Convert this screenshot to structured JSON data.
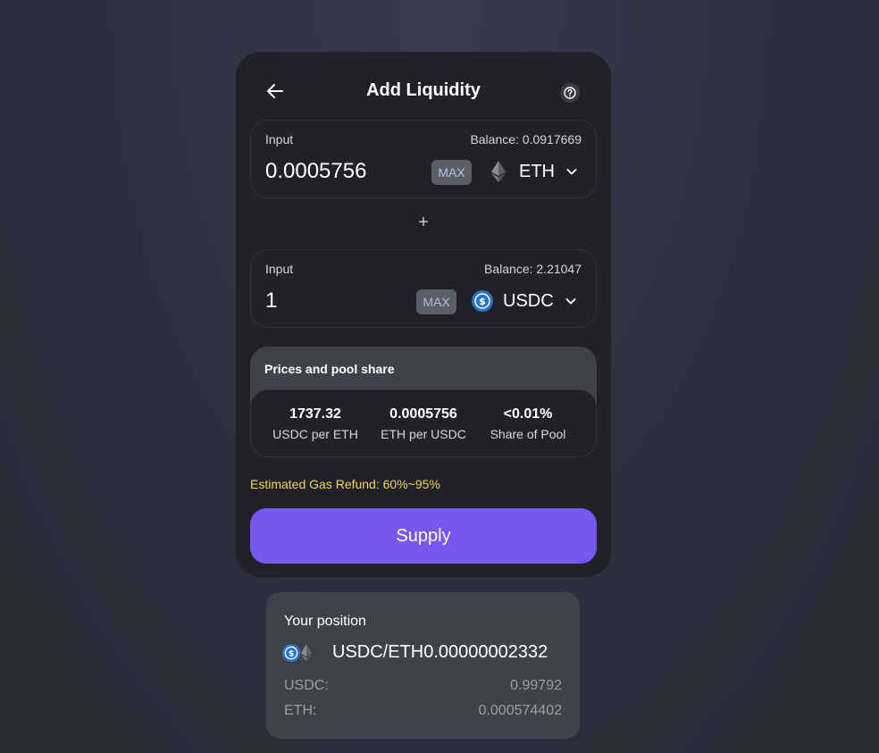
{
  "header": {
    "title": "Add Liquidity",
    "back_icon": "arrow-left-icon",
    "help_icon": "question-circle-icon"
  },
  "input_a": {
    "label": "Input",
    "balance": "Balance: 0.0917669",
    "value": "0.0005756",
    "max_label": "MAX",
    "token": "ETH",
    "token_icon": "eth-icon"
  },
  "plus_symbol": "+",
  "input_b": {
    "label": "Input",
    "balance": "Balance: 2.21047",
    "value": "1",
    "max_label": "MAX",
    "token": "USDC",
    "token_icon": "usdc-icon"
  },
  "prices": {
    "title": "Prices and pool share",
    "stats": [
      {
        "value": "1737.32",
        "label": "USDC per ETH"
      },
      {
        "value": "0.0005756",
        "label": "ETH per USDC"
      },
      {
        "value": "<0.01%",
        "label": "Share of Pool"
      }
    ]
  },
  "gas_refund": "Estimated Gas Refund: 60%~95%",
  "supply_label": "Supply",
  "position": {
    "title": "Your position",
    "pair_text": "USDC/ETH0.00000002332",
    "rows": [
      {
        "key": "USDC:",
        "value": "0.99792"
      },
      {
        "key": "ETH:",
        "value": "0.000574402"
      }
    ]
  },
  "colors": {
    "accent": "#7757ef",
    "card": "#202227",
    "panel": "#40424b",
    "warning_text": "#f3d45a",
    "usdc_blue": "#2775ca"
  }
}
